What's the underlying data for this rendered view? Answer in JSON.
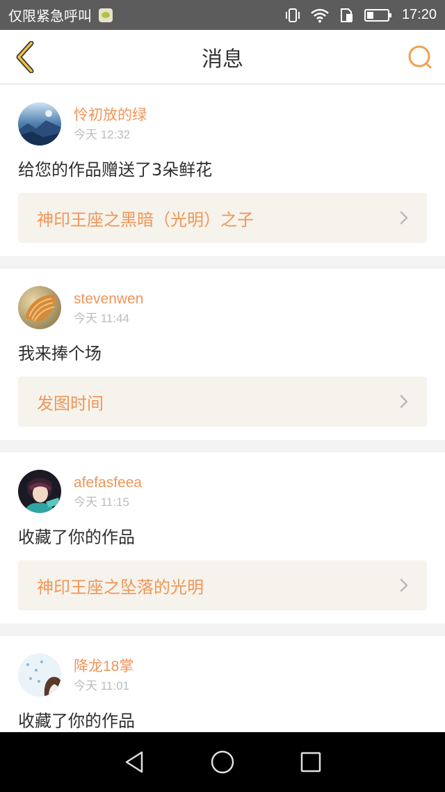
{
  "status_bar": {
    "carrier_text": "仅限紧急呼叫",
    "time": "17:20",
    "icons": [
      "app-notification-icon",
      "vibrate-icon",
      "wifi-icon",
      "sim-icon",
      "battery-icon"
    ]
  },
  "header": {
    "title": "消息",
    "back_icon": "chevron-left-icon",
    "search_icon": "search-icon",
    "accent_color": "#f0a050"
  },
  "messages": [
    {
      "username": "怜初放的绿",
      "time": "今天 12:32",
      "content": "给您的作品赠送了3朵鲜花",
      "work_title": "神印王座之黑暗（光明）之子"
    },
    {
      "username": "stevenwen",
      "time": "今天 11:44",
      "content": "我来捧个场",
      "work_title": "发图时间"
    },
    {
      "username": "afefasfeea",
      "time": "今天 11:15",
      "content": "收藏了你的作品",
      "work_title": "神印王座之坠落的光明"
    },
    {
      "username": "降龙18掌",
      "time": "今天 11:01",
      "content": "收藏了你的作品",
      "work_title": ""
    }
  ],
  "colors": {
    "username": "#f0955a",
    "work_title": "#ef9658",
    "work_bg": "#f6f3ec",
    "time": "#bcbcbc"
  },
  "nav_bar": {
    "icons": [
      "back-triangle-icon",
      "home-circle-icon",
      "recents-square-icon"
    ]
  }
}
